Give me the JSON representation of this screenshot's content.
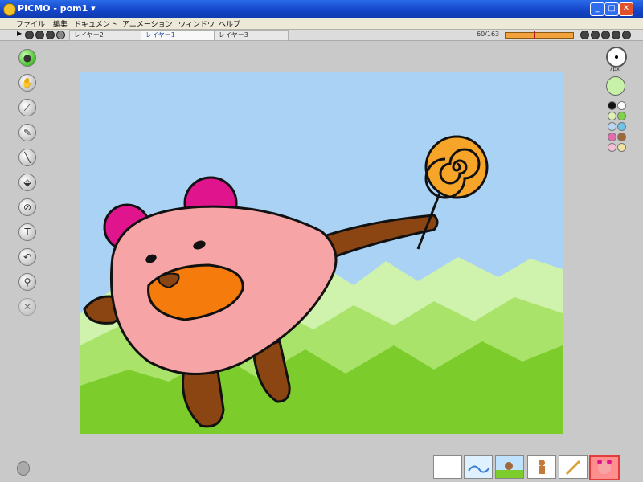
{
  "window": {
    "title": "PICMO - pom1 ▾",
    "controls": [
      "_",
      "□",
      "✕"
    ]
  },
  "menu": [
    "ファイル",
    "編集",
    "ドキュメント",
    "アニメーション",
    "ウィンドウ",
    "ヘルプ"
  ],
  "layers": [
    "レイヤー2",
    "レイヤー1",
    "レイヤー3"
  ],
  "active_layer_index": 1,
  "frame_counter": "60/163",
  "timeline_progress": 0.42,
  "tools": [
    {
      "name": "select-tool",
      "glyph": "●"
    },
    {
      "name": "hand-tool",
      "glyph": "✋"
    },
    {
      "name": "pencil-tool",
      "glyph": "⟋"
    },
    {
      "name": "brush-tool",
      "glyph": "✎"
    },
    {
      "name": "line-tool",
      "glyph": "╲"
    },
    {
      "name": "fill-tool",
      "glyph": "⬙"
    },
    {
      "name": "eyedropper-tool",
      "glyph": "⊘"
    },
    {
      "name": "text-tool",
      "glyph": "T"
    },
    {
      "name": "undo-tool",
      "glyph": "↶"
    },
    {
      "name": "zoom-tool",
      "glyph": "⚲"
    },
    {
      "name": "delete-tool",
      "glyph": "✕"
    }
  ],
  "pen_label": "7px",
  "current_color": "#c7f0a8",
  "palette": [
    "#111111",
    "#ffffff",
    "#e0f0b8",
    "#7ed34a",
    "#b9d8f6",
    "#6fc4e8",
    "#e56ab0",
    "#a0683a",
    "#f5c0d5",
    "#f3e3a2"
  ],
  "colors": {
    "sky": "#a9d2f5",
    "grass_light": "#cff2ad",
    "grass_mid": "#a9e36a",
    "grass_dark": "#7ccc2c",
    "bear_body": "#f7a4a6",
    "bear_ear": "#e0158e",
    "bear_muzzle": "#f47b0c",
    "bear_limb": "#8b4513",
    "lollipop": "#f7a528"
  }
}
